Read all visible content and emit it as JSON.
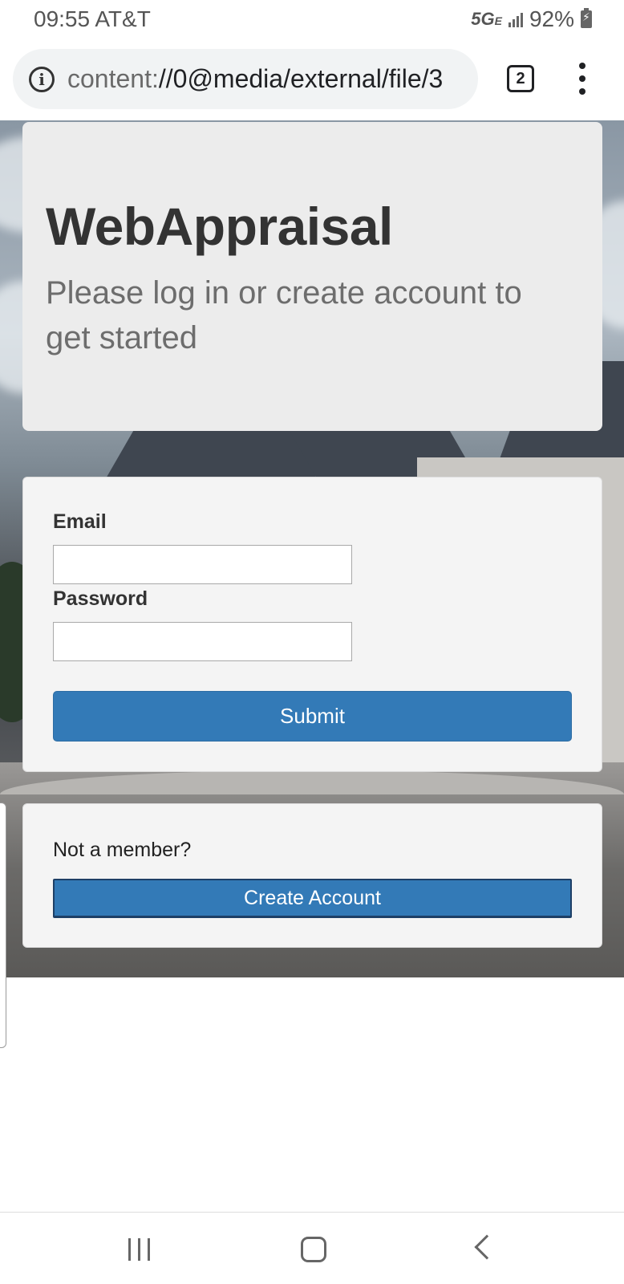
{
  "status_bar": {
    "time": "09:55",
    "carrier": "AT&T",
    "network": "5G",
    "network_suffix": "E",
    "battery": "92%"
  },
  "browser": {
    "url_scheme": "content:",
    "url_rest": "//0@media/external/file/3",
    "tab_count": "2"
  },
  "jumbotron": {
    "title": "WebAppraisal",
    "subtitle": "Please log in or create account to get started"
  },
  "login_form": {
    "email_label": "Email",
    "email_value": "",
    "password_label": "Password",
    "password_value": "",
    "submit_label": "Submit"
  },
  "signup": {
    "prompt": "Not a member?",
    "create_label": "Create Account"
  },
  "colors": {
    "primary_button": "#337ab7",
    "card_background": "#f4f4f4",
    "jumbotron_background": "#ececec"
  },
  "icons": [
    "info-icon",
    "tabs-icon",
    "menu-icon",
    "signal-icon",
    "battery-icon",
    "nav-recent-icon",
    "nav-home-icon",
    "nav-back-icon"
  ]
}
